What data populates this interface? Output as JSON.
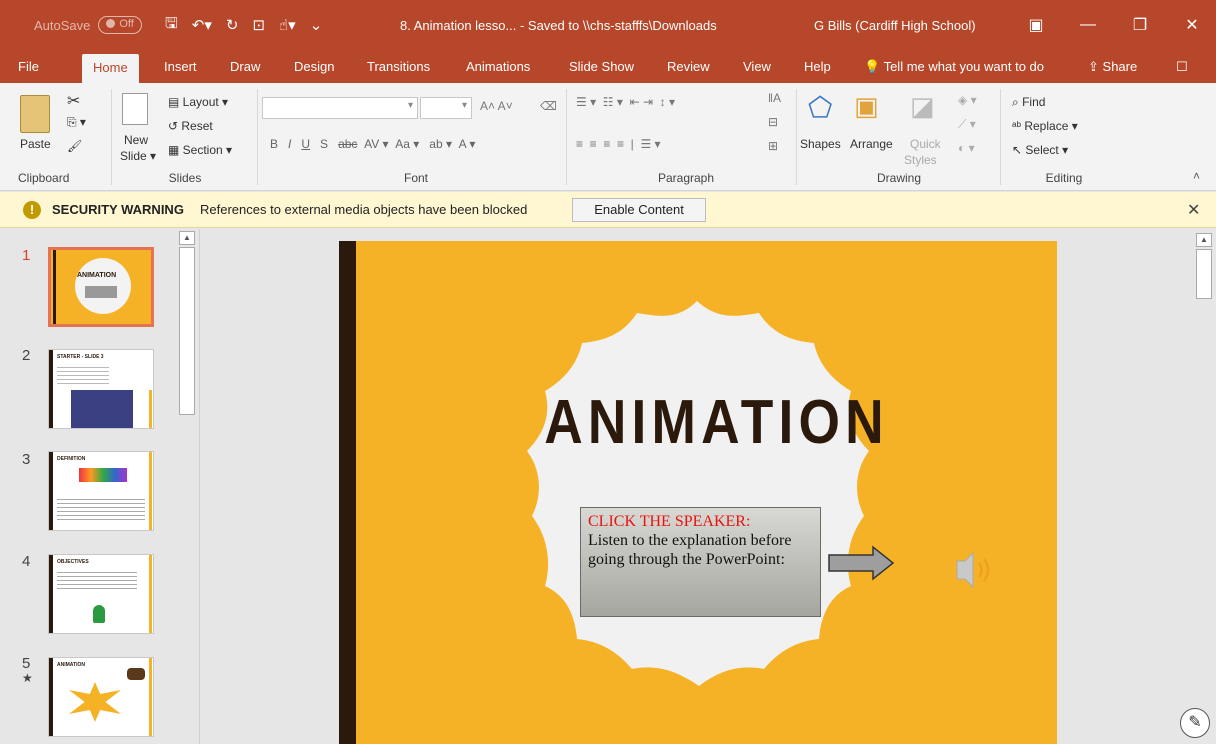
{
  "titlebar": {
    "autosave_label": "AutoSave",
    "autosave_state": "Off",
    "doc_title": "8. Animation lesso...  -  Saved to \\\\chs-stafffs\\Downloads",
    "user": "G Bills (Cardiff High School)"
  },
  "menu": {
    "tabs": [
      "File",
      "Home",
      "Insert",
      "Draw",
      "Design",
      "Transitions",
      "Animations",
      "Slide Show",
      "Review",
      "View",
      "Help"
    ],
    "tell_me": "Tell me what you want to do",
    "share": "Share"
  },
  "ribbon": {
    "clipboard": {
      "label": "Clipboard",
      "paste": "Paste"
    },
    "slides": {
      "label": "Slides",
      "new_slide_1": "New",
      "new_slide_2": "Slide",
      "layout": "Layout",
      "reset": "Reset",
      "section": "Section"
    },
    "font": {
      "label": "Font"
    },
    "paragraph": {
      "label": "Paragraph"
    },
    "drawing": {
      "label": "Drawing",
      "shapes": "Shapes",
      "arrange": "Arrange",
      "quick_1": "Quick",
      "quick_2": "Styles"
    },
    "editing": {
      "label": "Editing",
      "find": "Find",
      "replace": "Replace",
      "select": "Select"
    }
  },
  "security": {
    "title": "SECURITY WARNING",
    "message": "References to external media objects have been blocked",
    "button": "Enable Content"
  },
  "thumbnails": [
    {
      "num": "1",
      "title": "ANIMATION",
      "selected": true
    },
    {
      "num": "2",
      "title": "STARTER - SLIDE 3",
      "selected": false
    },
    {
      "num": "3",
      "title": "DEFINITION",
      "selected": false
    },
    {
      "num": "4",
      "title": "OBJECTIVES",
      "selected": false
    },
    {
      "num": "5",
      "title": "ANIMATION",
      "selected": false,
      "star": "★"
    }
  ],
  "slide": {
    "title": "ANIMATION",
    "callout_red": "CLICK THE SPEAKER:",
    "callout_body": "Listen to the explanation before going through the PowerPoint:"
  },
  "colors": {
    "accent": "#b7472a",
    "slide_bg": "#f6b226",
    "title_text": "#2b1a0c",
    "callout_red": "#e8120f"
  }
}
